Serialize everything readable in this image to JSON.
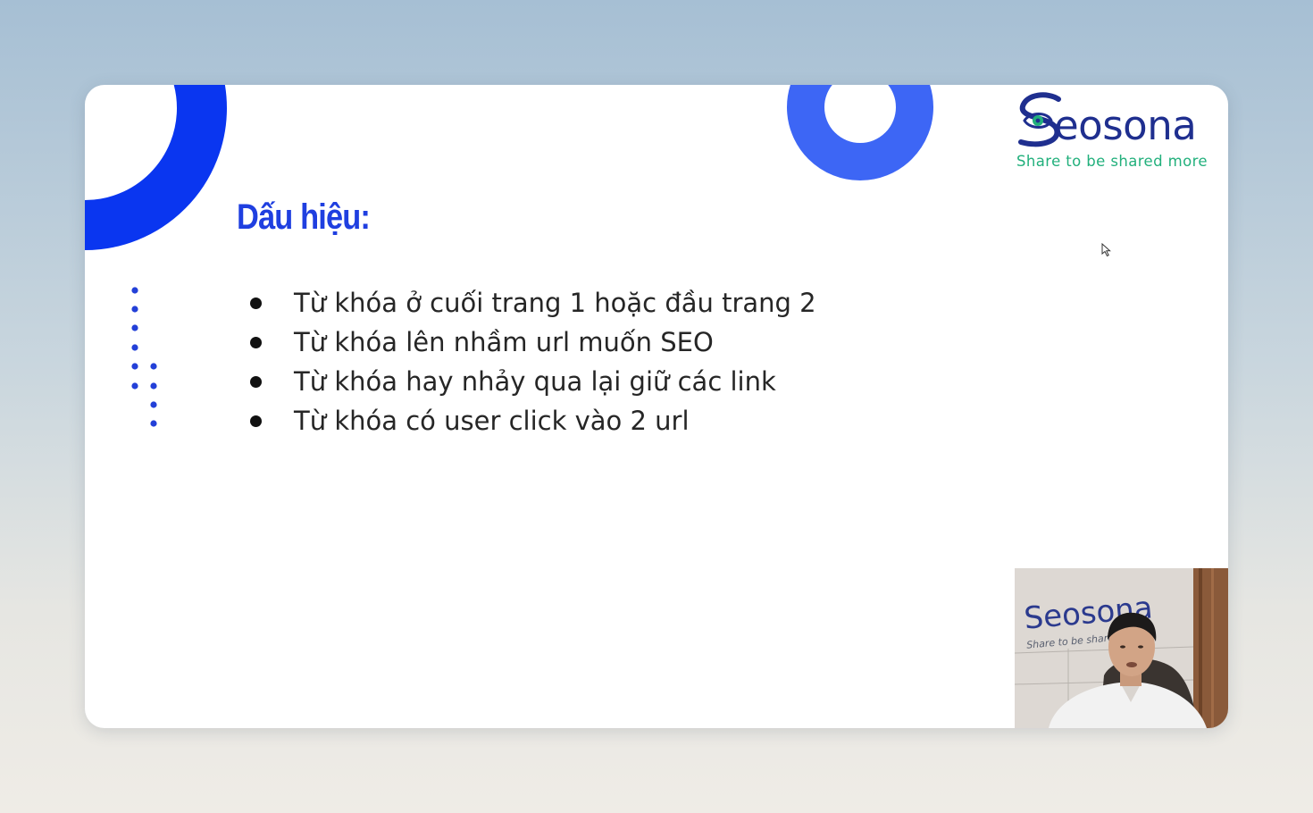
{
  "slide": {
    "title": "Dấu hiệu:",
    "bullets": [
      "Từ khóa ở cuối trang 1 hoặc đầu trang 2",
      "Từ khóa lên nhầm url muốn SEO",
      "Từ khóa hay nhảy qua lại giữ các link",
      "Từ khóa có user click vào 2 url"
    ],
    "logo": {
      "wordmark": "eosona",
      "tagline": "Share to be shared more"
    }
  },
  "webcam": {
    "sign_wordmark": "Seosona",
    "sign_tagline": "Share to be shared"
  },
  "colors": {
    "accent_blue": "#1f3fe0",
    "circle_blue": "#3d66f5",
    "logo_navy": "#1f2f8f",
    "logo_green": "#22b07c"
  },
  "icons": [
    "cursor-arrow-icon",
    "seosona-eye-icon"
  ]
}
